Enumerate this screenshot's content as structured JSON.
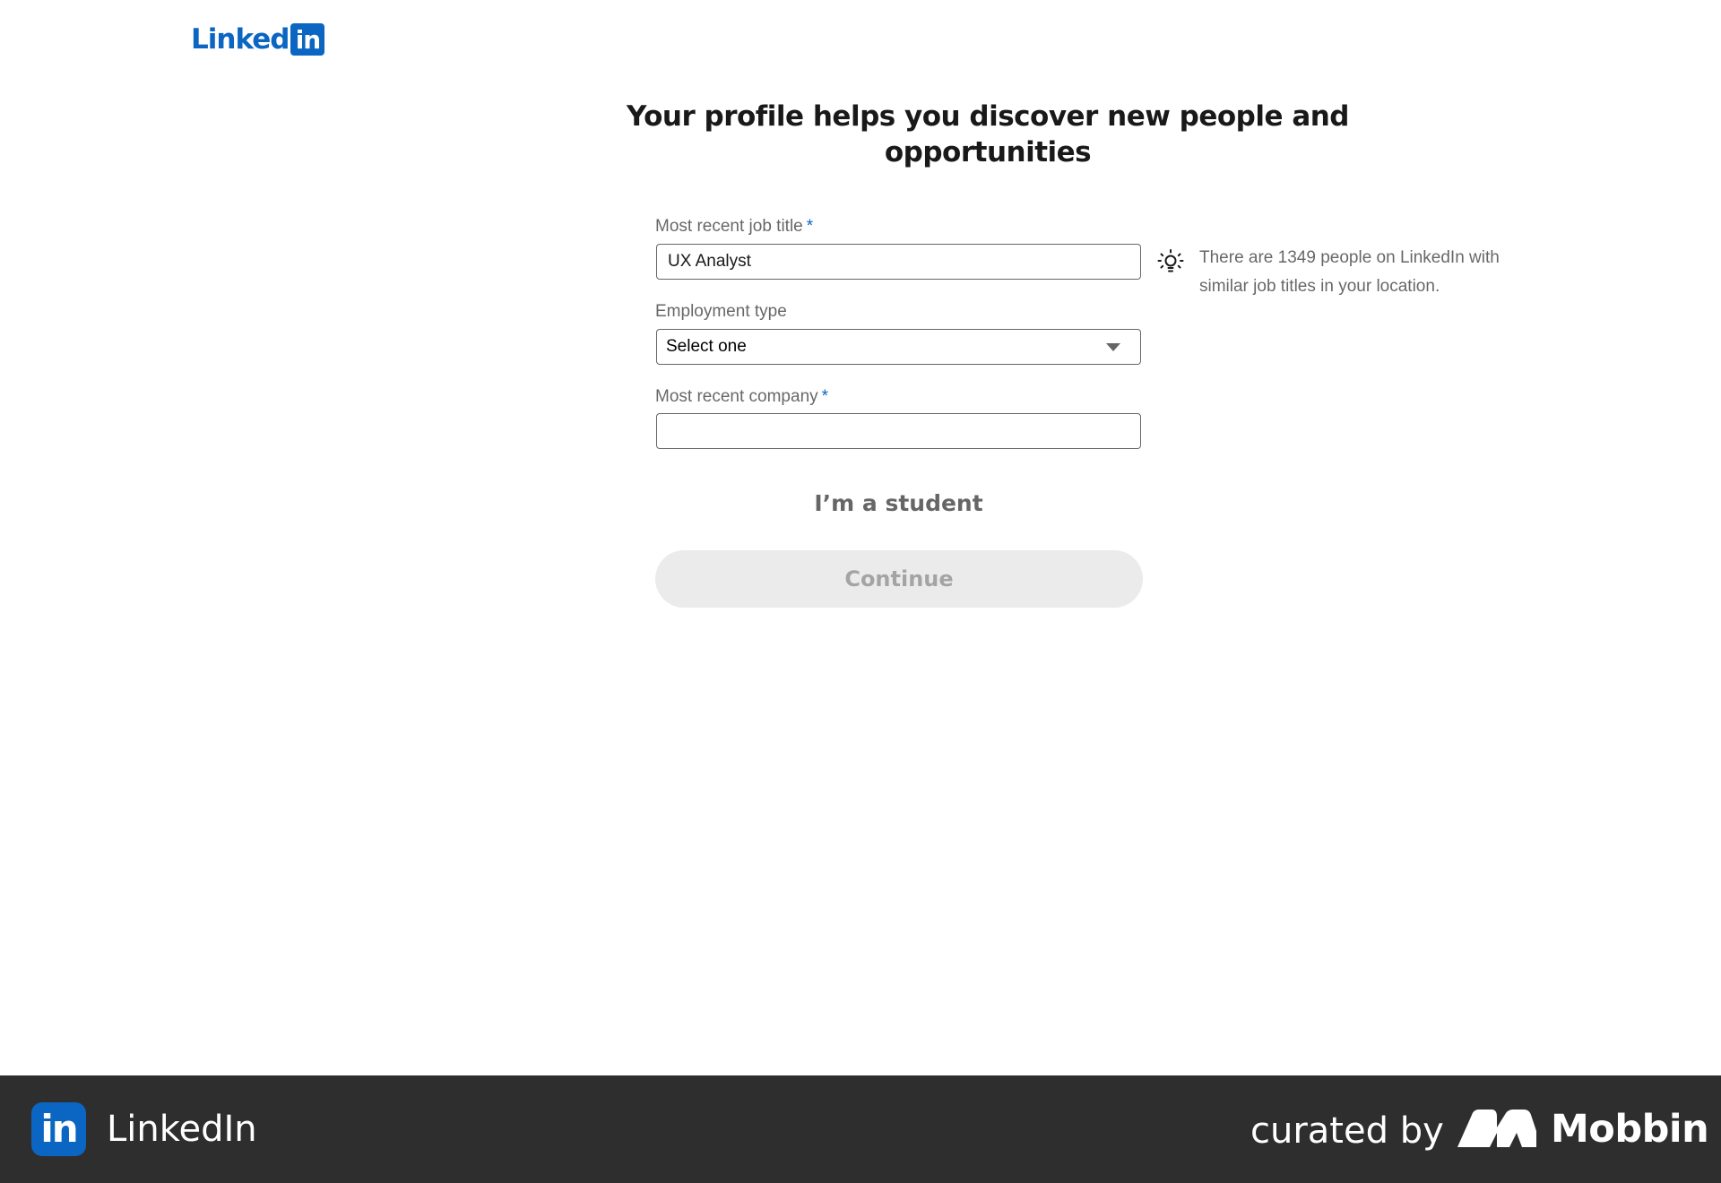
{
  "header": {
    "logo_text": "Linked",
    "logo_box_text": "in"
  },
  "main": {
    "headline": "Your profile helps you discover new people and opportunities",
    "job_title": {
      "label": "Most recent job title",
      "required_marker": "*",
      "value": "UX Analyst"
    },
    "employment_type": {
      "label": "Employment type",
      "selected": "Select one"
    },
    "company": {
      "label": "Most recent company",
      "required_marker": "*",
      "value": ""
    },
    "hint": {
      "icon": "lightbulb-icon",
      "text": "There are 1349 people on LinkedIn with similar job titles in your location."
    },
    "student_link": "I’m a student",
    "continue_label": "Continue"
  },
  "footer": {
    "app_icon_text": "in",
    "app_name": "LinkedIn",
    "curated_by": "curated by",
    "mobbin_name": "Mobbin"
  },
  "colors": {
    "brand": "#0a66c2",
    "footer_bg": "#2e2e2e",
    "button_disabled_bg": "#ebebeb"
  }
}
